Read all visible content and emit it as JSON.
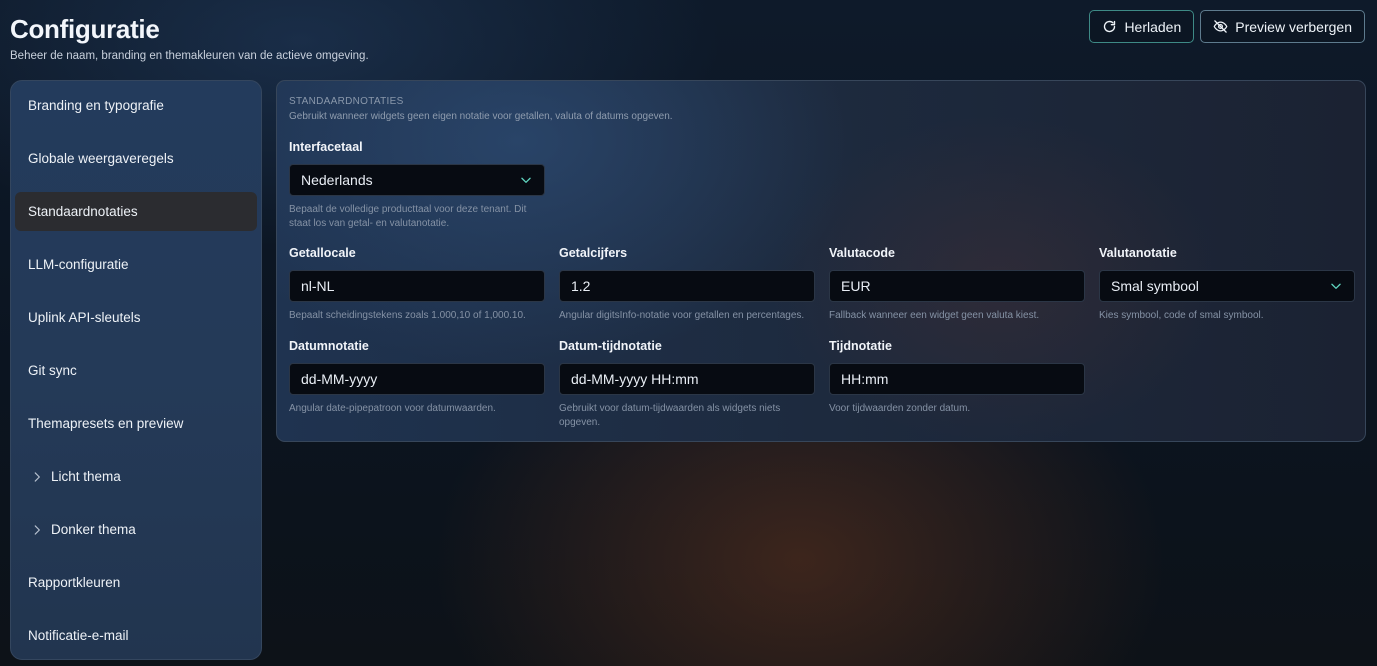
{
  "header": {
    "title": "Configuratie",
    "subtitle": "Beheer de naam, branding en themakleuren van de actieve omgeving.",
    "reload_label": "Herladen",
    "hide_preview_label": "Preview verbergen"
  },
  "sidebar": {
    "items": [
      {
        "label": "Branding en typografie"
      },
      {
        "label": "Globale weergaveregels"
      },
      {
        "label": "Standaardnotaties",
        "active": true
      },
      {
        "label": "LLM-configuratie"
      },
      {
        "label": "Uplink API-sleutels"
      },
      {
        "label": "Git sync"
      },
      {
        "label": "Themapresets en preview"
      },
      {
        "label": "Licht thema",
        "expandable": true
      },
      {
        "label": "Donker thema",
        "expandable": true
      },
      {
        "label": "Rapportkleuren"
      },
      {
        "label": "Notificatie-e-mail"
      }
    ]
  },
  "section": {
    "title": "STANDAARDNOTATIES",
    "description": "Gebruikt wanneer widgets geen eigen notatie voor getallen, valuta of datums opgeven."
  },
  "fields": {
    "interface_language": {
      "label": "Interfacetaal",
      "value": "Nederlands",
      "hint": "Bepaalt de volledige producttaal voor deze tenant. Dit staat los van getal- en valutanotatie."
    },
    "number_locale": {
      "label": "Getallocale",
      "value": "nl-NL",
      "hint": "Bepaalt scheidingstekens zoals 1.000,10 of 1,000.10."
    },
    "number_digits": {
      "label": "Getalcijfers",
      "value": "1.2",
      "hint": "Angular digitsInfo-notatie voor getallen en percentages."
    },
    "currency_code": {
      "label": "Valutacode",
      "value": "EUR",
      "hint": "Fallback wanneer een widget geen valuta kiest."
    },
    "currency_display": {
      "label": "Valutanotatie",
      "value": "Smal symbool",
      "hint": "Kies symbool, code of smal symbool."
    },
    "date_format": {
      "label": "Datumnotatie",
      "value": "dd-MM-yyyy",
      "hint": "Angular date-pipepatroon voor datumwaarden."
    },
    "datetime_format": {
      "label": "Datum-tijdnotatie",
      "value": "dd-MM-yyyy HH:mm",
      "hint": "Gebruikt voor datum-tijdwaarden als widgets niets opgeven."
    },
    "time_format": {
      "label": "Tijdnotatie",
      "value": "HH:mm",
      "hint": "Voor tijdwaarden zonder datum."
    }
  },
  "colors": {
    "accent_border": "#3e8a86",
    "select_caret": "#5fd4bf",
    "active_sidebar_bg": "#2b2c30"
  },
  "icons": {
    "reload": "refresh-icon",
    "hide_preview": "eye-off-icon",
    "expand": "chevron-right-icon",
    "select": "chevron-down-icon"
  }
}
